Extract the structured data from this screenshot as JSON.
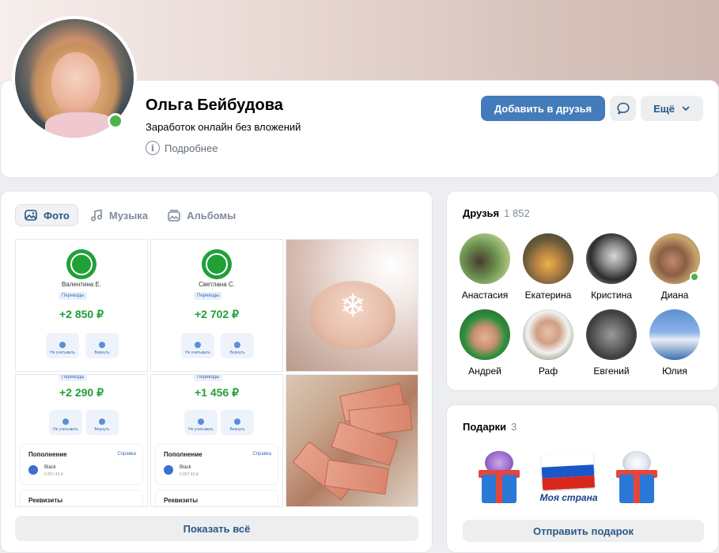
{
  "profile": {
    "name": "Ольга Бейбудова",
    "status": "Заработок онлайн без вложений",
    "more_info": "Подробнее",
    "online": true
  },
  "actions": {
    "add_friend": "Добавить в друзья",
    "more": "Ещё"
  },
  "media": {
    "tabs": [
      {
        "label": "Фото",
        "icon": "photo-icon",
        "active": true
      },
      {
        "label": "Музыка",
        "icon": "music-icon",
        "active": false
      },
      {
        "label": "Альбомы",
        "icon": "albums-icon",
        "active": false
      }
    ],
    "show_all": "Показать всё",
    "photos": [
      {
        "name": "Валентина Е.",
        "chip": "Переводы",
        "amount": "+2 850 ₽",
        "btn1": "Не учитывать",
        "btn2": "Вернуть"
      },
      {
        "name": "Светлана С.",
        "chip": "Переводы",
        "amount": "+2 702 ₽",
        "btn1": "Не учитывать",
        "btn2": "Вернуть"
      },
      {
        "chip": "Переводы",
        "amount": "+2 290 ₽",
        "btn1": "Не учитывать",
        "btn2": "Вернуть",
        "section": "Пополнение",
        "section_link": "Справка",
        "bank": "Black",
        "bank_sub": "5 857,43 ₽",
        "section2": "Реквизиты"
      },
      {
        "chip": "Переводы",
        "amount": "+1 456 ₽",
        "btn1": "Не учитывать",
        "btn2": "Вернуть",
        "section": "Пополнение",
        "section_link": "Справка",
        "bank": "Black",
        "bank_sub": "5 857,43 ₽",
        "section2": "Реквизиты"
      }
    ]
  },
  "friends": {
    "title": "Друзья",
    "count": "1 852",
    "items": [
      {
        "name": "Анастасия",
        "online": false
      },
      {
        "name": "Екатерина",
        "online": false
      },
      {
        "name": "Кристина",
        "online": false
      },
      {
        "name": "Диана",
        "online": true
      },
      {
        "name": "Андрей",
        "online": false
      },
      {
        "name": "Раф",
        "online": false
      },
      {
        "name": "Евгений",
        "online": false
      },
      {
        "name": "Юлия",
        "online": false
      }
    ]
  },
  "gifts": {
    "title": "Подарки",
    "count": "3",
    "flag_text": "Моя страна",
    "send": "Отправить подарок"
  },
  "colors": {
    "accent": "#447bba",
    "link": "#2a5885",
    "online": "#4bb34b",
    "money_green": "#21a038"
  }
}
